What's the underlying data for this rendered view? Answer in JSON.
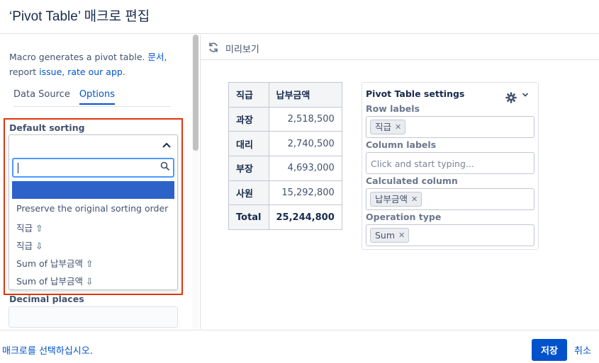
{
  "dialog": {
    "title": "‘Pivot Table’ 매크로 편집"
  },
  "left_panel": {
    "description_text": "Macro generates a pivot table. ",
    "description_link_docs": "문서",
    "description_comma": ",",
    "description_report": "report ",
    "description_link_issue": "issue",
    "description_sep": ", ",
    "description_link_rate": "rate our app",
    "description_dot": ".",
    "tabs": [
      {
        "label": "Data Source",
        "active": false
      },
      {
        "label": "Options",
        "active": true
      }
    ],
    "default_sorting": {
      "label": "Default sorting",
      "search_value": "",
      "options": [
        "",
        "Preserve the original sorting order",
        "직급 ⇧",
        "직급 ⇩",
        "Sum of 납부금액 ⇧",
        "Sum of 납부금액 ⇩"
      ]
    },
    "decimal_places": {
      "label": "Decimal places",
      "value": ""
    }
  },
  "preview": {
    "title": "미리보기",
    "table": {
      "headers": [
        "직급",
        "납부금액"
      ],
      "rows": [
        [
          "과장",
          "2,518,500"
        ],
        [
          "대리",
          "2,740,500"
        ],
        [
          "부장",
          "4,693,000"
        ],
        [
          "사원",
          "15,292,800"
        ]
      ],
      "total": [
        "Total",
        "25,244,800"
      ]
    },
    "settings": {
      "title": "Pivot Table settings",
      "row_labels": {
        "label": "Row labels",
        "chip": "직급"
      },
      "column_labels": {
        "label": "Column labels",
        "placeholder": "Click and start typing..."
      },
      "calculated_column": {
        "label": "Calculated column",
        "chip": "납부금액"
      },
      "operation_type": {
        "label": "Operation type",
        "chip": "Sum"
      }
    }
  },
  "footer": {
    "select_macro_link": "매크로를 선택하십시오.",
    "save_label": "저장",
    "cancel_label": "취소"
  },
  "colors": {
    "accent": "#0052cc",
    "highlight": "#2d62c8",
    "error_outline": "#de350b"
  },
  "icons": {
    "refresh": "refresh-icon",
    "gear": "gear-icon",
    "search": "search-icon",
    "chevron_up": "chevron-up-icon",
    "chevron_down": "chevron-down-icon",
    "remove": "close-icon"
  }
}
